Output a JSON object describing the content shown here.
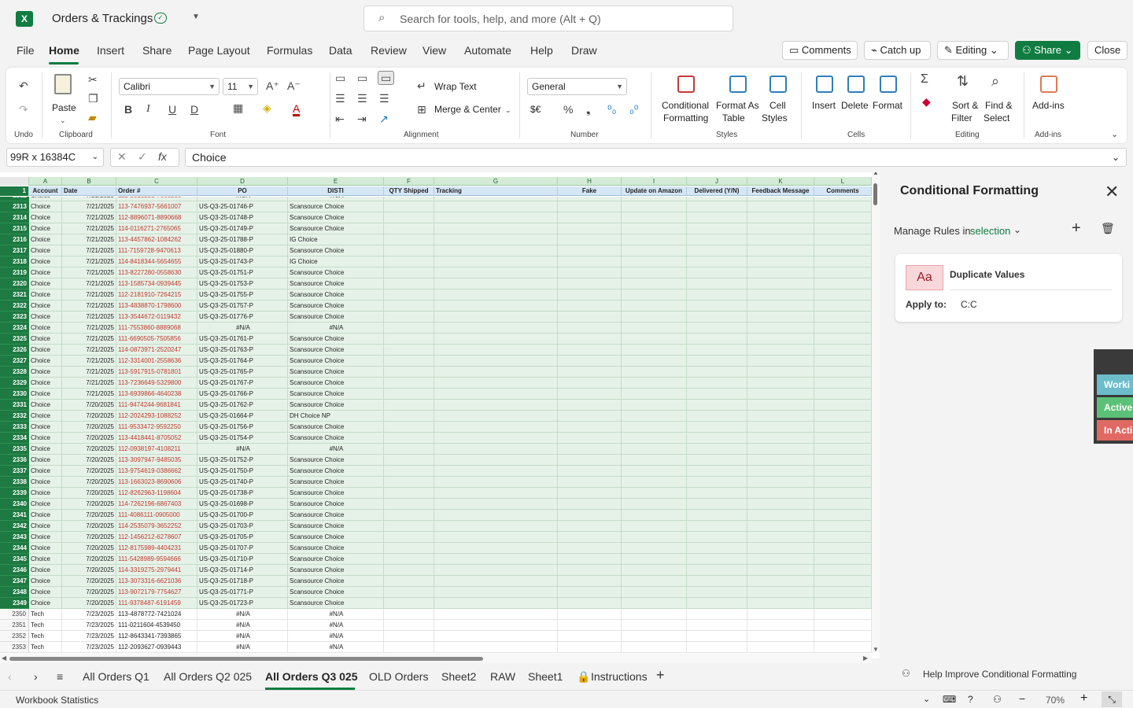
{
  "app": {
    "title": "Orders & Trackings"
  },
  "search": {
    "placeholder": "Search for tools, help, and more (Alt + Q)"
  },
  "menu": [
    "File",
    "Home",
    "Insert",
    "Share",
    "Page Layout",
    "Formulas",
    "Data",
    "Review",
    "View",
    "Automate",
    "Help",
    "Draw"
  ],
  "topbuttons": {
    "comments": "Comments",
    "catchup": "Catch up",
    "editing": "Editing",
    "share": "Share",
    "close": "Close"
  },
  "ribbon": {
    "undo_label": "Undo",
    "clipboard_label": "Clipboard",
    "paste": "Paste",
    "font_label": "Font",
    "font_name": "Calibri",
    "font_size": "11",
    "alignment_label": "Alignment",
    "wrap": "Wrap Text",
    "merge": "Merge & Center",
    "number_label": "Number",
    "number_format": "General",
    "currency": "$€",
    "styles_label": "Styles",
    "cond_fmt_1": "Conditional",
    "cond_fmt_2": "Formatting",
    "fmt_table_1": "Format As",
    "fmt_table_2": "Table",
    "cell_styles_1": "Cell",
    "cell_styles_2": "Styles",
    "cells_label": "Cells",
    "insert": "Insert",
    "delete": "Delete",
    "format": "Format",
    "editing_label": "Editing",
    "sort_1": "Sort &",
    "sort_2": "Filter",
    "find_1": "Find &",
    "find_2": "Select",
    "addins_label": "Add-ins",
    "addins": "Add-ins"
  },
  "formula": {
    "namebox": "99R x 16384C",
    "value": "Choice"
  },
  "columns": [
    "A",
    "B",
    "C",
    "D",
    "E",
    "F",
    "G",
    "H",
    "I",
    "J",
    "K",
    "L"
  ],
  "headers": [
    "Account",
    "Date",
    "Order #",
    "PO",
    "DISTI",
    "QTY Shipped",
    "Tracking",
    "",
    "Fake",
    "Update on Amazon",
    "Delivered (Y/N)",
    "Feedback Message",
    "Comments"
  ],
  "rows": [
    [
      "2312",
      "Choice",
      "7/21/2025",
      "112-9515255-7668256",
      "#N/A",
      "#N/A"
    ],
    [
      "2313",
      "Choice",
      "7/21/2025",
      "113-7476937-5661007",
      "US-Q3-25-01746-P",
      "Scansource Choice"
    ],
    [
      "2314",
      "Choice",
      "7/21/2025",
      "112-8896071-8890668",
      "US-Q3-25-01748-P",
      "Scansource Choice"
    ],
    [
      "2315",
      "Choice",
      "7/21/2025",
      "114-0116271-2765065",
      "US-Q3-25-01749-P",
      "Scansource Choice"
    ],
    [
      "2316",
      "Choice",
      "7/21/2025",
      "113-4457862-1084262",
      "US-Q3-25-01788-P",
      "IG Choice"
    ],
    [
      "2317",
      "Choice",
      "7/21/2025",
      "111-7159728-9470613",
      "US-Q3-25-01880-P",
      "Scansource Choice"
    ],
    [
      "2318",
      "Choice",
      "7/21/2025",
      "114-8418344-5654655",
      "US-Q3-25-01743-P",
      "IG Choice"
    ],
    [
      "2319",
      "Choice",
      "7/21/2025",
      "113-8227280-0558630",
      "US-Q3-25-01751-P",
      "Scansource Choice"
    ],
    [
      "2320",
      "Choice",
      "7/21/2025",
      "113-1585734-0939445",
      "US-Q3-25-01753-P",
      "Scansource Choice"
    ],
    [
      "2321",
      "Choice",
      "7/21/2025",
      "112-2181910-7264215",
      "US-Q3-25-01755-P",
      "Scansource Choice"
    ],
    [
      "2322",
      "Choice",
      "7/21/2025",
      "113-4838870-1798600",
      "US-Q3-25-01757-P",
      "Scansource Choice"
    ],
    [
      "2323",
      "Choice",
      "7/21/2025",
      "113-3544672-0119432",
      "US-Q3-25-01776-P",
      "Scansource Choice"
    ],
    [
      "2324",
      "Choice",
      "7/21/2025",
      "111-7553860-8889068",
      "#N/A",
      "#N/A"
    ],
    [
      "2325",
      "Choice",
      "7/21/2025",
      "111-6690505-7505856",
      "US-Q3-25-01761-P",
      "Scansource Choice"
    ],
    [
      "2326",
      "Choice",
      "7/21/2025",
      "114-0873971-2520247",
      "US-Q3-25-01763-P",
      "Scansource Choice"
    ],
    [
      "2327",
      "Choice",
      "7/21/2025",
      "112-3314001-2558636",
      "US-Q3-25-01764-P",
      "Scansource Choice"
    ],
    [
      "2328",
      "Choice",
      "7/21/2025",
      "113-5917915-0781801",
      "US-Q3-25-01765-P",
      "Scansource Choice"
    ],
    [
      "2329",
      "Choice",
      "7/21/2025",
      "113-7236649-5329800",
      "US-Q3-25-01767-P",
      "Scansource Choice"
    ],
    [
      "2330",
      "Choice",
      "7/21/2025",
      "113-6939866-4640238",
      "US-Q3-25-01766-P",
      "Scansource Choice"
    ],
    [
      "2331",
      "Choice",
      "7/20/2025",
      "111-9474244-9681841",
      "US-Q3-25-01762-P",
      "Scansource Choice"
    ],
    [
      "2332",
      "Choice",
      "7/20/2025",
      "112-2024293-1088252",
      "US-Q3-25-01664-P",
      "DH Choice NP"
    ],
    [
      "2333",
      "Choice",
      "7/20/2025",
      "111-9533472-9592250",
      "US-Q3-25-01756-P",
      "Scansource Choice"
    ],
    [
      "2334",
      "Choice",
      "7/20/2025",
      "113-4418441-8705052",
      "US-Q3-25-01754-P",
      "Scansource Choice"
    ],
    [
      "2335",
      "Choice",
      "7/20/2025",
      "112-0938197-4108211",
      "#N/A",
      "#N/A"
    ],
    [
      "2336",
      "Choice",
      "7/20/2025",
      "113-3097947-9485035",
      "US-Q3-25-01752-P",
      "Scansource Choice"
    ],
    [
      "2337",
      "Choice",
      "7/20/2025",
      "113-9754619-0386662",
      "US-Q3-25-01750-P",
      "Scansource Choice"
    ],
    [
      "2338",
      "Choice",
      "7/20/2025",
      "113-1663023-8690606",
      "US-Q3-25-01740-P",
      "Scansource Choice"
    ],
    [
      "2339",
      "Choice",
      "7/20/2025",
      "112-8262963-1198604",
      "US-Q3-25-01738-P",
      "Scansource Choice"
    ],
    [
      "2340",
      "Choice",
      "7/20/2025",
      "114-7262196-6867403",
      "US-Q3-25-01698-P",
      "Scansource Choice"
    ],
    [
      "2341",
      "Choice",
      "7/20/2025",
      "111-4086111-0905000",
      "US-Q3-25-01700-P",
      "Scansource Choice"
    ],
    [
      "2342",
      "Choice",
      "7/20/2025",
      "114-2535079-3652252",
      "US-Q3-25-01703-P",
      "Scansource Choice"
    ],
    [
      "2343",
      "Choice",
      "7/20/2025",
      "112-1456212-6278607",
      "US-Q3-25-01705-P",
      "Scansource Choice"
    ],
    [
      "2344",
      "Choice",
      "7/20/2025",
      "112-8175989-4404231",
      "US-Q3-25-01707-P",
      "Scansource Choice"
    ],
    [
      "2345",
      "Choice",
      "7/20/2025",
      "111-5428989-9594666",
      "US-Q3-25-01710-P",
      "Scansource Choice"
    ],
    [
      "2346",
      "Choice",
      "7/20/2025",
      "114-3319275-2979441",
      "US-Q3-25-01714-P",
      "Scansource Choice"
    ],
    [
      "2347",
      "Choice",
      "7/20/2025",
      "113-3073316-6621036",
      "US-Q3-25-01718-P",
      "Scansource Choice"
    ],
    [
      "2348",
      "Choice",
      "7/20/2025",
      "113-9072179-7754627",
      "US-Q3-25-01771-P",
      "Scansource Choice"
    ],
    [
      "2349",
      "Choice",
      "7/20/2025",
      "111-9378487-6191459",
      "US-Q3-25-01723-P",
      "Scansource Choice"
    ],
    [
      "2350",
      "Tech",
      "7/23/2025",
      "113-4878772-7421024",
      "#N/A",
      "#N/A"
    ],
    [
      "2351",
      "Tech",
      "7/23/2025",
      "111-0211604-4539450",
      "#N/A",
      "#N/A"
    ],
    [
      "2352",
      "Tech",
      "7/23/2025",
      "112-8643341-7393865",
      "#N/A",
      "#N/A"
    ],
    [
      "2353",
      "Tech",
      "7/23/2025",
      "112-2093627-0939443",
      "#N/A",
      "#N/A"
    ]
  ],
  "tabs": [
    "All Orders Q1",
    "All Orders Q2 025",
    "All Orders Q3 025",
    "OLD Orders",
    "Sheet2",
    "RAW",
    "Sheet1",
    "Instructions"
  ],
  "status": {
    "left": "Workbook Statistics",
    "zoom": "70%"
  },
  "panel": {
    "title": "Conditional Formatting",
    "manage_label": "Manage Rules in",
    "manage_scope": "selection",
    "rule_sample": "Aa",
    "rule_name": "Duplicate Values",
    "apply_label": "Apply to:",
    "apply_range": "C:C",
    "help": "Help Improve Conditional Formatting"
  },
  "sticky": [
    "Worki",
    "Active",
    "In Acti"
  ],
  "colors": {
    "accent": "#107c41",
    "dup_fill": "#f8d7da",
    "dup_text": "#9c1c24",
    "sticky_working": "#6cbccc",
    "sticky_active": "#5cc178",
    "sticky_inactive": "#e06a63"
  }
}
